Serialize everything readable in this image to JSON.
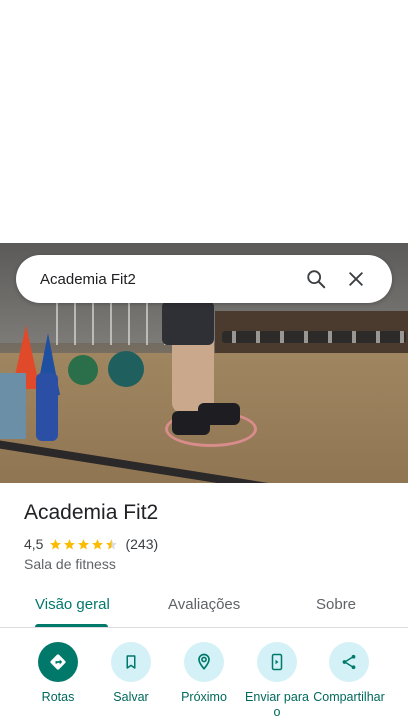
{
  "search": {
    "query": "Academia Fit2"
  },
  "place": {
    "title": "Academia Fit2",
    "rating": "4,5",
    "stars": 4.5,
    "reviews": "(243)",
    "category": "Sala de fitness"
  },
  "tabs": [
    {
      "label": "Visão geral",
      "active": true
    },
    {
      "label": "Avaliações",
      "active": false
    },
    {
      "label": "Sobre",
      "active": false
    }
  ],
  "actions": [
    {
      "label": "Rotas",
      "icon": "directions-icon"
    },
    {
      "label": "Salvar",
      "icon": "bookmark-icon"
    },
    {
      "label": "Próximo",
      "icon": "nearby-icon"
    },
    {
      "label": "Enviar para o",
      "icon": "send-to-phone-icon"
    },
    {
      "label": "Compartilhar",
      "icon": "share-icon"
    }
  ],
  "colors": {
    "accent": "#00796b",
    "chip": "#d3f1f6",
    "star": "#fbbc04"
  }
}
